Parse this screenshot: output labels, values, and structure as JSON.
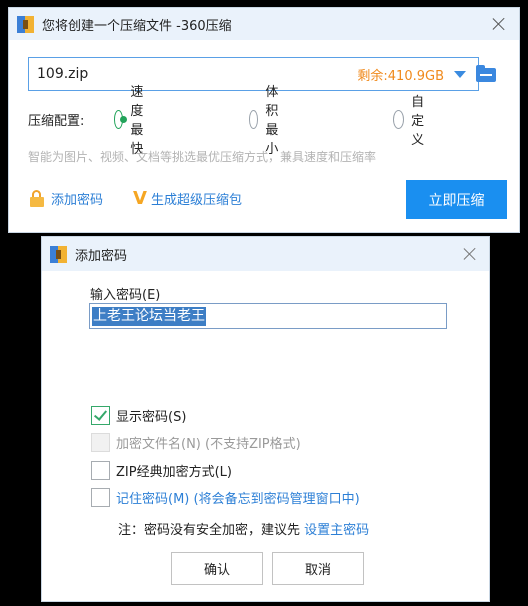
{
  "compress_window": {
    "title": "您将创建一个压缩文件 -360压缩",
    "file_name": "109.zip",
    "free_space": "剩余:410.9GB",
    "config_label": "压缩配置:",
    "options": [
      "速度最快",
      "体积最小",
      "自定义"
    ],
    "selected_option": "速度最快",
    "hint": "智能为图片、视频、文档等挑选最优压缩方式，兼具速度和压缩率",
    "add_password_link": "添加密码",
    "super_pack_link": "生成超级压缩包",
    "compress_button": "立即压缩",
    "colors": {
      "accent": "#1a8ff0",
      "free_space": "#f08a1d",
      "radio_on": "#22a35a"
    }
  },
  "password_dialog": {
    "title": "添加密码",
    "input_label": "输入密码(E)",
    "password_value": "上老王论坛当老王",
    "checkboxes": [
      {
        "label": "显示密码(S)",
        "checked": true,
        "disabled": false
      },
      {
        "label": "加密文件名(N) (不支持ZIP格式)",
        "checked": false,
        "disabled": true
      },
      {
        "label": "ZIP经典加密方式(L)",
        "checked": false,
        "disabled": false
      },
      {
        "label": "记住密码(M) (将会备忘到密码管理窗口中)",
        "checked": false,
        "disabled": false
      }
    ],
    "note_prefix": "注：密码没有安全加密，建议先 ",
    "note_link": "设置主密码",
    "ok_button": "确认",
    "cancel_button": "取消"
  }
}
